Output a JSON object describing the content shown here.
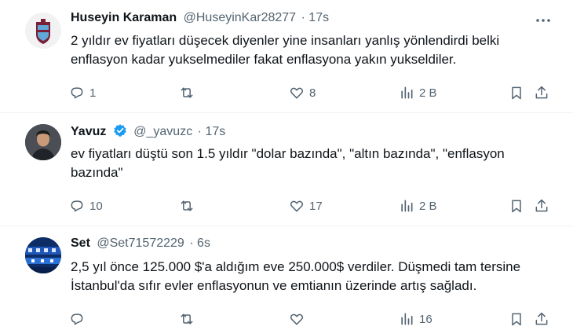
{
  "tweets": [
    {
      "name": "Huseyin Karaman",
      "handle": "@HuseyinKar28277",
      "separator": "·",
      "time": "17s",
      "verified": false,
      "text": "2 yıldır ev fiyatları düşecek diyenler yine insanları yanlış yönlendirdi belki enflasyon kadar yukselmediler fakat enflasyona yakın yukseldiler.",
      "replies": "1",
      "retweets": "",
      "likes": "8",
      "views": "2 B",
      "avatar_icon": "team-crest-avatar"
    },
    {
      "name": "Yavuz",
      "handle": "@_yavuzc",
      "separator": "·",
      "time": "17s",
      "verified": true,
      "text": "ev fiyatları düştü son 1.5 yıldır \"dolar bazında\", \"altın bazında\", \"enflasyon bazında\"",
      "replies": "10",
      "retweets": "",
      "likes": "17",
      "views": "2 B",
      "avatar_icon": "person-photo-avatar"
    },
    {
      "name": "Set",
      "handle": "@Set71572229",
      "separator": "·",
      "time": "6s",
      "verified": false,
      "text": "2,5 yıl önce 125.000 $'a aldığım eve 250.000$ verdiler. Düşmedi tam tersine İstanbul'da sıfır evler enflasyonun ve emtianın üzerinde artış sağladı.",
      "replies": "",
      "retweets": "",
      "likes": "",
      "views": "16",
      "avatar_icon": "stadium-photo-avatar"
    }
  ],
  "colors": {
    "text": "#0f1419",
    "secondary": "#536471",
    "verified": "#1d9bf0",
    "divider": "#eff3f4",
    "crest_maroon": "#7a1f35",
    "crest_blue": "#5fa8d8"
  }
}
